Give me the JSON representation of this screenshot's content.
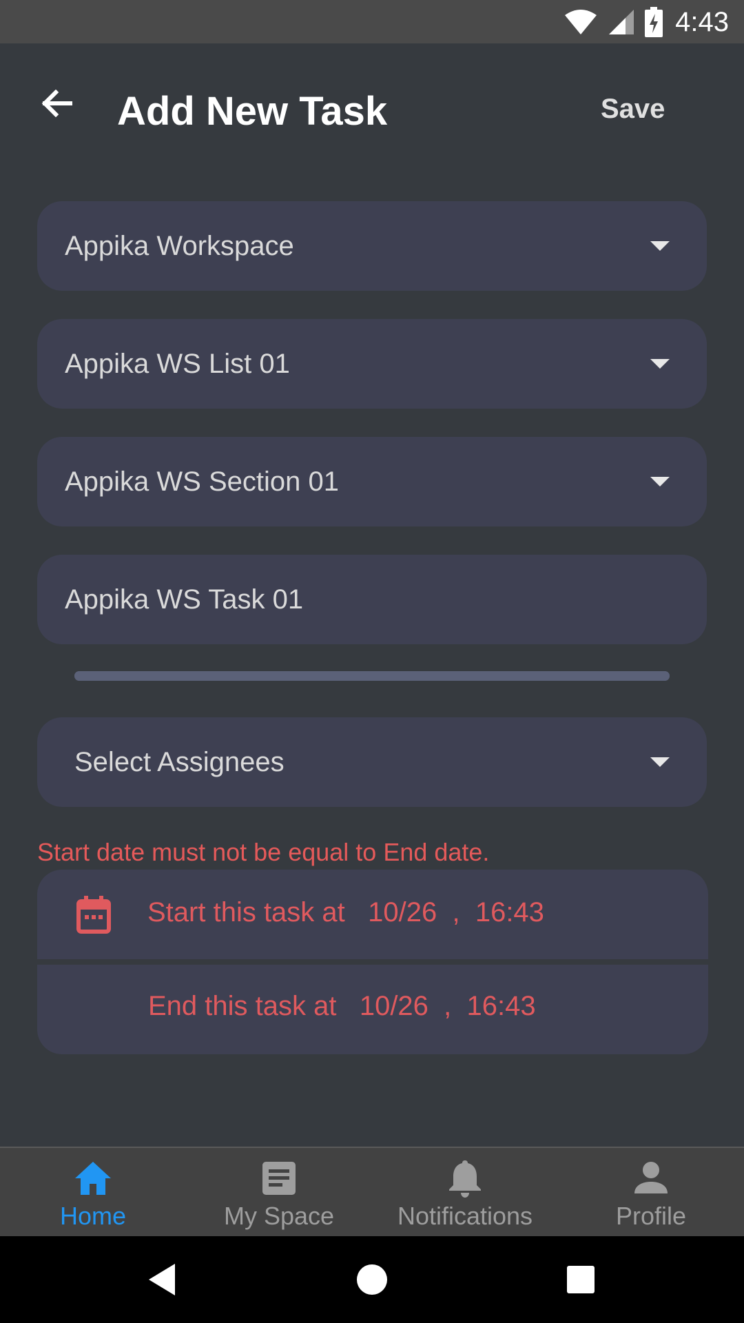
{
  "status_bar": {
    "time": "4:43",
    "icons": [
      "wifi-icon",
      "signal-icon",
      "battery-charging-icon"
    ]
  },
  "app_bar": {
    "back_icon": "arrow-left-icon",
    "title": "Add New Task",
    "save_label": "Save"
  },
  "form": {
    "workspace": {
      "value": "Appika Workspace"
    },
    "list": {
      "value": "Appika WS List 01"
    },
    "section": {
      "value": "Appika WS Section 01"
    },
    "task_name": {
      "value": "Appika WS Task 01"
    },
    "progress": {
      "fraction": 1.0
    },
    "assignees": {
      "placeholder": "Select Assignees"
    },
    "error": "Start date must not be equal to End date.",
    "start": {
      "label": "Start this task at",
      "date": "10/26",
      "separator": ",",
      "time": "16:43"
    },
    "end": {
      "label": "End this task at",
      "date": "10/26",
      "separator": ",",
      "time": "16:43"
    }
  },
  "bottom_nav": {
    "items": [
      {
        "label": "Home",
        "icon": "home-icon",
        "active": true
      },
      {
        "label": "My Space",
        "icon": "document-icon",
        "active": false
      },
      {
        "label": "Notifications",
        "icon": "bell-icon",
        "active": false
      },
      {
        "label": "Profile",
        "icon": "person-icon",
        "active": false
      }
    ]
  },
  "system_nav": [
    "back-triangle-icon",
    "home-circle-icon",
    "recents-square-icon"
  ],
  "colors": {
    "background": "#363A3F",
    "field": "#3E4052",
    "error": "#E55A5A",
    "accent": "#2196F3"
  }
}
